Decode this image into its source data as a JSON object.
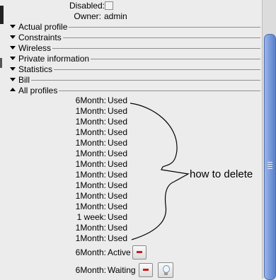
{
  "fields": {
    "disabled_label": "Disabled:",
    "disabled_checked": false,
    "owner_label": "Owner:",
    "owner_value": "admin"
  },
  "sections": [
    {
      "title": "Actual profile",
      "expanded": false
    },
    {
      "title": "Constraints",
      "expanded": false
    },
    {
      "title": "Wireless",
      "expanded": false
    },
    {
      "title": "Private information",
      "expanded": false
    },
    {
      "title": "Statistics",
      "expanded": false
    },
    {
      "title": "Bill",
      "expanded": false
    },
    {
      "title": "All profiles",
      "expanded": true
    }
  ],
  "profiles": [
    {
      "name": "6Month:",
      "status": "Used"
    },
    {
      "name": "1Month:",
      "status": "Used"
    },
    {
      "name": "1Month:",
      "status": "Used"
    },
    {
      "name": "1Month:",
      "status": "Used"
    },
    {
      "name": "1Month:",
      "status": "Used"
    },
    {
      "name": "1Month:",
      "status": "Used"
    },
    {
      "name": "1Month:",
      "status": "Used"
    },
    {
      "name": "1Month:",
      "status": "Used"
    },
    {
      "name": "1Month:",
      "status": "Used"
    },
    {
      "name": "1Month:",
      "status": "Used"
    },
    {
      "name": "1Month:",
      "status": "Used"
    },
    {
      "name": "1 week:",
      "status": "Used"
    },
    {
      "name": "1Month:",
      "status": "Used"
    },
    {
      "name": "1Month:",
      "status": "Used"
    }
  ],
  "active_profile": {
    "name": "6Month:",
    "status": "Active"
  },
  "waiting_profile": {
    "name": "6Month:",
    "status": "Waiting"
  },
  "annotation": {
    "text": "how to delete"
  },
  "icons": {
    "remove": "minus-icon",
    "activate": "lightbulb-icon",
    "collapsed": "triangle-down-icon",
    "expanded": "triangle-up-icon"
  },
  "colors": {
    "remove_red": "#d01818",
    "scroll_blue": "#6f94d8"
  }
}
